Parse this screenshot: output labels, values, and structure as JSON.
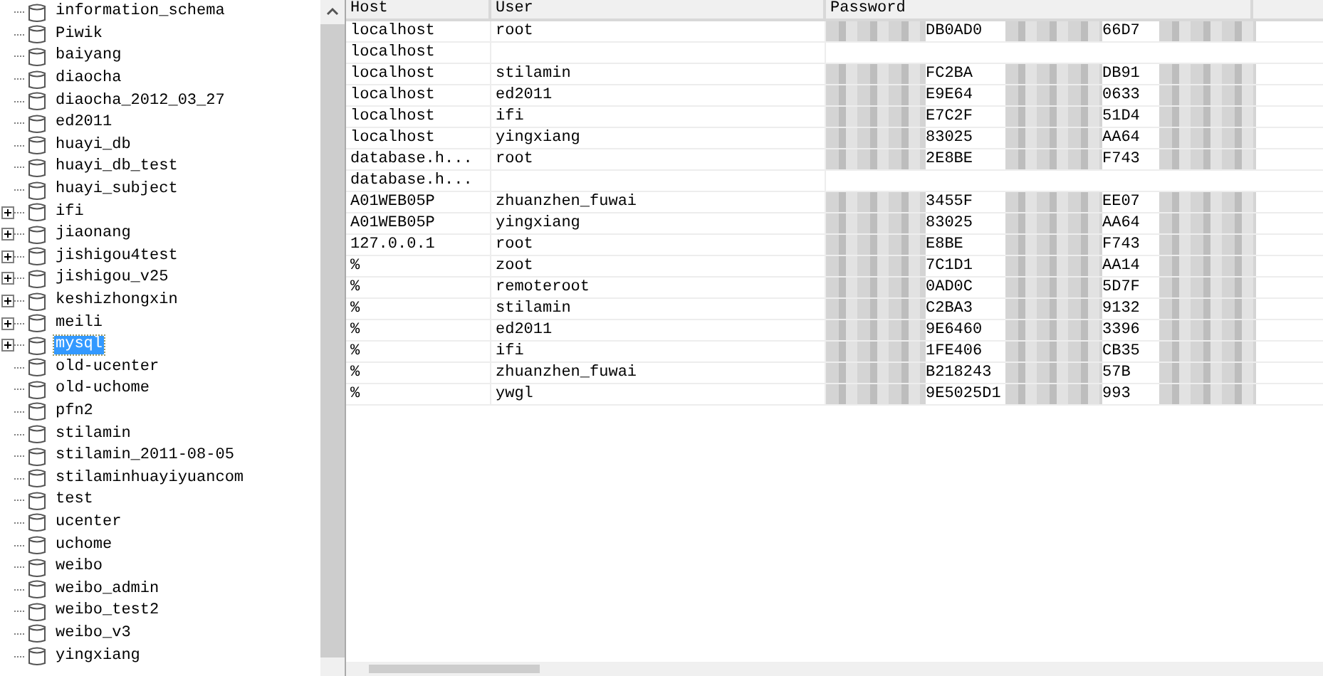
{
  "databases": [
    {
      "name": "information_schema",
      "expandable": false,
      "selected": false
    },
    {
      "name": "Piwik",
      "expandable": false,
      "selected": false
    },
    {
      "name": "baiyang",
      "expandable": false,
      "selected": false
    },
    {
      "name": "diaocha",
      "expandable": false,
      "selected": false
    },
    {
      "name": "diaocha_2012_03_27",
      "expandable": false,
      "selected": false
    },
    {
      "name": "ed2011",
      "expandable": false,
      "selected": false
    },
    {
      "name": "huayi_db",
      "expandable": false,
      "selected": false
    },
    {
      "name": "huayi_db_test",
      "expandable": false,
      "selected": false
    },
    {
      "name": "huayi_subject",
      "expandable": false,
      "selected": false
    },
    {
      "name": "ifi",
      "expandable": true,
      "selected": false
    },
    {
      "name": "jiaonang",
      "expandable": true,
      "selected": false
    },
    {
      "name": "jishigou4test",
      "expandable": true,
      "selected": false
    },
    {
      "name": "jishigou_v25",
      "expandable": true,
      "selected": false
    },
    {
      "name": "keshizhongxin",
      "expandable": true,
      "selected": false
    },
    {
      "name": "meili",
      "expandable": true,
      "selected": false
    },
    {
      "name": "mysql",
      "expandable": true,
      "selected": true
    },
    {
      "name": "old-ucenter",
      "expandable": false,
      "selected": false
    },
    {
      "name": "old-uchome",
      "expandable": false,
      "selected": false
    },
    {
      "name": "pfn2",
      "expandable": false,
      "selected": false
    },
    {
      "name": "stilamin",
      "expandable": false,
      "selected": false
    },
    {
      "name": "stilamin_2011-08-05",
      "expandable": false,
      "selected": false
    },
    {
      "name": "stilaminhuayiyuancom",
      "expandable": false,
      "selected": false
    },
    {
      "name": "test",
      "expandable": false,
      "selected": false
    },
    {
      "name": "ucenter",
      "expandable": false,
      "selected": false
    },
    {
      "name": "uchome",
      "expandable": false,
      "selected": false
    },
    {
      "name": "weibo",
      "expandable": false,
      "selected": false
    },
    {
      "name": "weibo_admin",
      "expandable": false,
      "selected": false
    },
    {
      "name": "weibo_test2",
      "expandable": false,
      "selected": false
    },
    {
      "name": "weibo_v3",
      "expandable": false,
      "selected": false
    },
    {
      "name": "yingxiang",
      "expandable": false,
      "selected": false
    }
  ],
  "table": {
    "columns": [
      "Host",
      "User",
      "Password"
    ],
    "rows": [
      {
        "host": "localhost",
        "user": "root",
        "password": [
          "DB0AD0",
          "66D7"
        ]
      },
      {
        "host": "localhost",
        "user": "",
        "password": []
      },
      {
        "host": "localhost",
        "user": "stilamin",
        "password": [
          "FC2BA",
          "DB91"
        ]
      },
      {
        "host": "localhost",
        "user": "ed2011",
        "password": [
          "E9E64",
          "0633"
        ]
      },
      {
        "host": "localhost",
        "user": "ifi",
        "password": [
          "E7C2F",
          "51D4"
        ]
      },
      {
        "host": "localhost",
        "user": "yingxiang",
        "password": [
          "83025",
          "AA64"
        ]
      },
      {
        "host": "database.h...",
        "user": "root",
        "password": [
          "2E8BE",
          "F743"
        ]
      },
      {
        "host": "database.h...",
        "user": "",
        "password": []
      },
      {
        "host": "A01WEB05P",
        "user": "zhuanzhen_fuwai",
        "password": [
          "3455F",
          "EE07"
        ]
      },
      {
        "host": "A01WEB05P",
        "user": "yingxiang",
        "password": [
          "83025",
          "AA64"
        ]
      },
      {
        "host": "127.0.0.1",
        "user": "root",
        "password": [
          "E8BE",
          "F743"
        ]
      },
      {
        "host": "%",
        "user": "zoot",
        "password": [
          "7C1D1",
          "AA14"
        ]
      },
      {
        "host": "%",
        "user": "remoteroot",
        "password": [
          "0AD0C",
          "5D7F"
        ]
      },
      {
        "host": "%",
        "user": "stilamin",
        "password": [
          "C2BA3",
          "9132"
        ]
      },
      {
        "host": "%",
        "user": "ed2011",
        "password": [
          "9E6460",
          "3396"
        ]
      },
      {
        "host": "%",
        "user": "ifi",
        "password": [
          "1FE406",
          "CB35"
        ]
      },
      {
        "host": "%",
        "user": "zhuanzhen_fuwai",
        "password": [
          "B218243",
          "57B"
        ]
      },
      {
        "host": "%",
        "user": "ywgl",
        "password": [
          "9E5025D1",
          "993"
        ]
      }
    ]
  }
}
